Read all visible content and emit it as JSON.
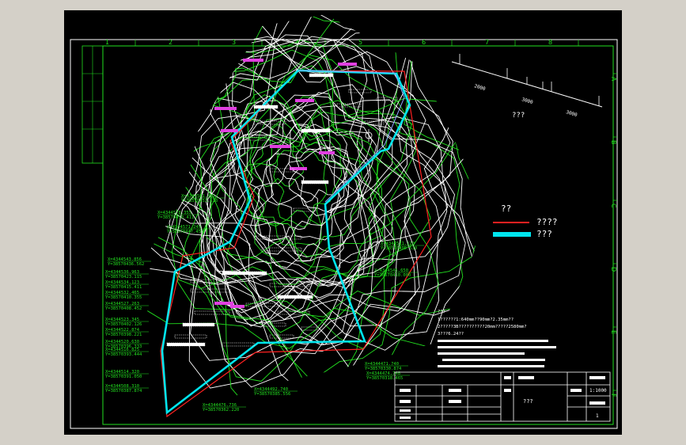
{
  "scale_bar": {
    "tick_labels": [
      "2000",
      "3000",
      "3000"
    ],
    "caption": "???"
  },
  "legend": {
    "title": "??",
    "items": [
      {
        "label": "????",
        "color": "#ff2020"
      },
      {
        "label": "???",
        "color": "#00e5ee"
      }
    ]
  },
  "notes": {
    "heading": "???",
    "lines": [
      "1??????1:640mm??90mm?2.35mm??",
      "2?????3B??????????20mm?????2580mm?",
      "3???6.24??"
    ]
  },
  "grid_top_numbers": [
    "1",
    "2",
    "3",
    "4",
    "5",
    "6",
    "7",
    "8"
  ],
  "grid_side_letters": [
    "A",
    "B",
    "C",
    "D",
    "E",
    "F"
  ],
  "coordinates": [
    "X=4344581.421",
    "Y=38570453.530",
    "X=4344578.355",
    "Y=38570450.411",
    "X=4344571.249",
    "Y=38570447.450",
    "X=4344543.856",
    "Y=38570436.562",
    "X=4344536.963",
    "Y=38570423.115",
    "X=4344534.123",
    "Y=38570415.411",
    "X=4344532.465",
    "Y=38570410.355",
    "X=4344527.263",
    "Y=38570408.452",
    "X=4344523.345",
    "Y=38570402.126",
    "X=4344522.874",
    "Y=38570398.221",
    "X=4344520.630",
    "Y=38570396.333",
    "X=4344516.825",
    "Y=38570393.444",
    "X=4344514.320",
    "Y=38570391.050",
    "X=4344508.310",
    "Y=38570387.874",
    "X=4344492.740",
    "Y=38570385.556",
    "X=4344476.736",
    "Y=38570362.220",
    "X=4344471.740",
    "Y=38570330.874",
    "X=4344474.748",
    "Y=38570318.465",
    "X=4344521.120",
    "Y=38570405.530",
    "X=4344545.650",
    "Y=38570410.000"
  ],
  "title_block": {
    "drawing_name": "???",
    "scale": "1:1000",
    "sheet": "1"
  }
}
